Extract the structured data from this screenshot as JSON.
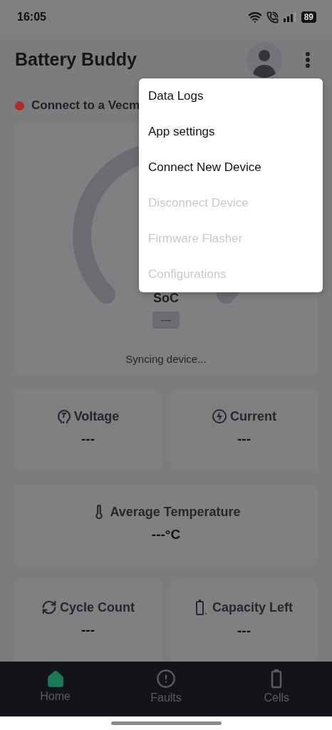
{
  "status_bar": {
    "time": "16:05",
    "battery": "89"
  },
  "app_bar": {
    "title": "Battery Buddy"
  },
  "connection": {
    "text": "Connect to a Vecm",
    "connected": false
  },
  "gauge": {
    "label": "SoC",
    "value": "---",
    "status": "Syncing device..."
  },
  "metric_rows": [
    [
      {
        "label": "Voltage",
        "value": "---"
      },
      {
        "label": "Current",
        "value": "---"
      }
    ],
    [
      {
        "label": "Average Temperature",
        "value": "---°C"
      }
    ],
    [
      {
        "label": "Cycle Count",
        "value": "---"
      },
      {
        "label": "Capacity Left",
        "value": "---"
      }
    ]
  ],
  "menu": [
    {
      "label": "Data Logs",
      "disabled": false
    },
    {
      "label": "App settings",
      "disabled": false
    },
    {
      "label": "Connect New Device",
      "disabled": false
    },
    {
      "label": "Disconnect Device",
      "disabled": true
    },
    {
      "label": "Firmware Flasher",
      "disabled": true
    },
    {
      "label": "Configurations",
      "disabled": true
    }
  ],
  "nav": [
    {
      "label": "Home",
      "selected": true
    },
    {
      "label": "Faults",
      "selected": false
    },
    {
      "label": "Cells",
      "selected": false
    }
  ]
}
